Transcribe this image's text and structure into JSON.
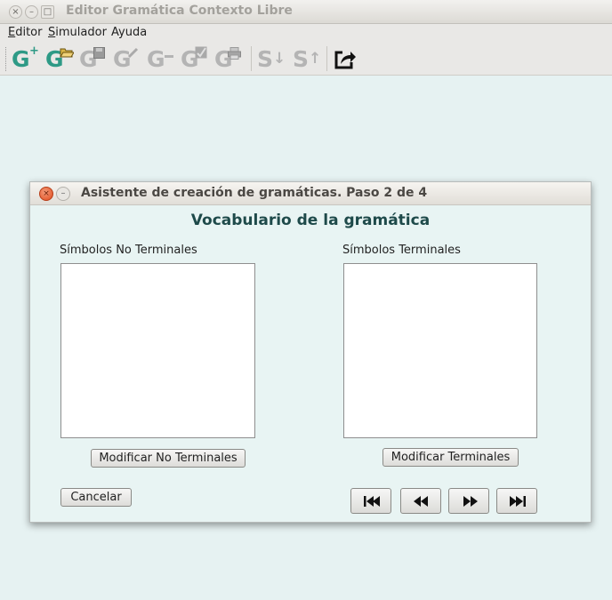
{
  "window": {
    "title": "Editor Gramática Contexto Libre",
    "controls": [
      "×",
      "–",
      "□"
    ]
  },
  "menubar": {
    "items": [
      {
        "label": "Editor",
        "mnemonic": "E",
        "rest": "ditor"
      },
      {
        "label": "Simulador",
        "mnemonic": "S",
        "rest": "imulador"
      },
      {
        "label": "Ayuda",
        "mnemonic": "",
        "rest": "Ayuda"
      }
    ]
  },
  "toolbar": {
    "colors": {
      "enabled": "#2e9a86",
      "disabled": "#b4b4b4"
    },
    "buttons": [
      {
        "icon": "grammar-new-icon",
        "glyph": "G",
        "badge": "+",
        "enabled": true
      },
      {
        "icon": "grammar-open-icon",
        "glyph": "G",
        "badge": "folder",
        "enabled": true
      },
      {
        "icon": "grammar-save-icon",
        "glyph": "G",
        "badge": "disk",
        "enabled": false
      },
      {
        "icon": "grammar-validate-icon",
        "glyph": "G",
        "badge": "✓",
        "enabled": false
      },
      {
        "icon": "grammar-remove-icon",
        "glyph": "G",
        "badge": "−",
        "enabled": false
      },
      {
        "icon": "grammar-check-icon",
        "glyph": "G",
        "badge": "check",
        "enabled": false
      },
      {
        "icon": "grammar-print-icon",
        "glyph": "G",
        "badge": "print",
        "enabled": false
      },
      {
        "icon": "symbol-down-icon",
        "glyph": "S",
        "badge": "↓",
        "enabled": false
      },
      {
        "icon": "symbol-up-icon",
        "glyph": "S",
        "badge": "↑",
        "enabled": false
      },
      {
        "icon": "export-icon",
        "glyph": "",
        "badge": "",
        "enabled": true
      }
    ]
  },
  "dialog": {
    "title": "Asistente de creación de gramáticas. Paso 2 de 4",
    "heading": "Vocabulario de la gramática",
    "nonterminals": {
      "label": "Símbolos No Terminales",
      "items": [],
      "button": "Modificar No Terminales"
    },
    "terminals": {
      "label": "Símbolos Terminales",
      "items": [],
      "button": "Modificar Terminales"
    },
    "cancel": "Cancelar",
    "nav": [
      "first-page-icon",
      "previous-icon",
      "next-icon",
      "last-page-icon"
    ]
  }
}
